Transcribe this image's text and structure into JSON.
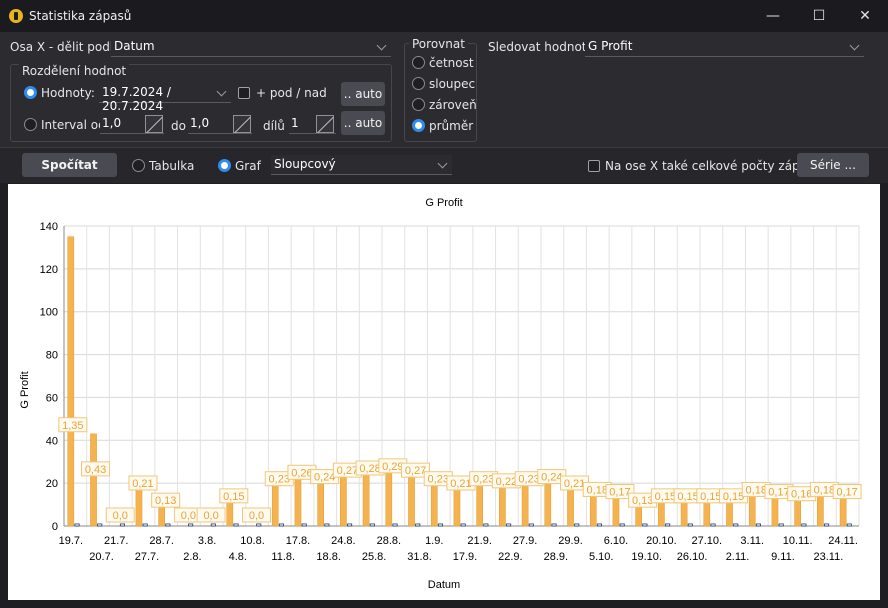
{
  "window": {
    "title": "Statistika zápasů",
    "minimize_glyph": "—",
    "maximize_glyph": "☐",
    "close_glyph": "✕",
    "icon": "app-logo-icon"
  },
  "settings": {
    "osa_x_label": "Osa X - dělit podle",
    "osa_x_value": "Datum",
    "rozdeleni_title": "Rozdělení hodnot",
    "hodnoty_label": "Hodnoty:",
    "hodnoty_value": "19.7.2024 / 20.7.2024",
    "pod_nad_label": "+ pod / nad",
    "auto1_label": ".. auto",
    "interval_label": "Interval od",
    "interval_from": "1,0",
    "do_label": "do",
    "interval_to": "1,0",
    "dilu_label": "dílů",
    "dilu_value": "1",
    "auto2_label": ".. auto",
    "porovnat_title": "Porovnat",
    "porovnat_options": [
      "četnost",
      "sloupec",
      "zároveň",
      "průměr"
    ],
    "porovnat_selected": "průměr",
    "sledovat_label": "Sledovat hodnoty",
    "sledovat_value": "G Profit"
  },
  "toolbar": {
    "spocitat_label": "Spočítat",
    "tabulka_label": "Tabulka",
    "graf_label": "Graf",
    "view_selected": "Graf",
    "chart_type_value": "Sloupcový",
    "totals_label": "Na ose X také celkové počty zápasů",
    "serie_label": "Série ..."
  },
  "colors": {
    "bar": "#f5b350",
    "bar_stroke": "#e09a30",
    "secondary_bar": "#1f3b73",
    "label_border": "#f2c57a",
    "label_text": "#e8a23a",
    "accent": "#2f8df0"
  },
  "chart_data": {
    "type": "bar",
    "title": "G Profit",
    "xlabel": "Datum",
    "ylabel": "G Profit",
    "ylim": [
      0,
      140
    ],
    "yticks": [
      0,
      20,
      40,
      60,
      80,
      100,
      120,
      140
    ],
    "grid": true,
    "categories": [
      "19.7.",
      "20.7.",
      "21.7.",
      "27.7.",
      "28.7.",
      "2.8.",
      "3.8.",
      "4.8.",
      "10.8.",
      "11.8.",
      "17.8.",
      "18.8.",
      "24.8.",
      "25.8.",
      "28.8.",
      "31.8.",
      "1.9.",
      "17.9.",
      "21.9.",
      "22.9.",
      "27.9.",
      "28.9.",
      "29.9.",
      "5.10.",
      "6.10.",
      "19.10.",
      "20.10.",
      "26.10.",
      "27.10.",
      "2.11.",
      "3.11.",
      "9.11.",
      "10.11.",
      "23.11.",
      "24.11."
    ],
    "series": [
      {
        "values": [
          135,
          43,
          0,
          21,
          13,
          0,
          0,
          15,
          0,
          23,
          26,
          24,
          27,
          28,
          29,
          27,
          23,
          21,
          23,
          22,
          23,
          24,
          21,
          18,
          17,
          13,
          15,
          15,
          15,
          15,
          18,
          17,
          16,
          18,
          17
        ]
      },
      {
        "values": [
          0.5,
          0.5,
          0.5,
          0.5,
          0.5,
          0.5,
          0.5,
          0.5,
          0.5,
          0.5,
          0.5,
          0.5,
          0.5,
          0.5,
          0.5,
          0.5,
          0.5,
          0.5,
          0.5,
          0.5,
          0.5,
          0.5,
          0.5,
          0.5,
          0.5,
          0.5,
          0.5,
          0.5,
          0.5,
          0.5,
          0.5,
          0.5,
          0.5,
          0.5,
          0.5
        ]
      }
    ],
    "data_labels": [
      "1,35",
      "0,43",
      "0,0",
      "0,21",
      "0,13",
      "0,0",
      "0,0",
      "0,15",
      "0,0",
      "0,23",
      "0,26",
      "0,24",
      "0,27",
      "0,28",
      "0,29",
      "0,27",
      "0,23",
      "0,21",
      "0,23",
      "0,22",
      "0,23",
      "0,24",
      "0,21",
      "0,18",
      "0,17",
      "0,13",
      "0,15",
      "0,15",
      "0,15",
      "0,15",
      "0,18",
      "0,17",
      "0,16",
      "0,18",
      "0,17"
    ]
  }
}
